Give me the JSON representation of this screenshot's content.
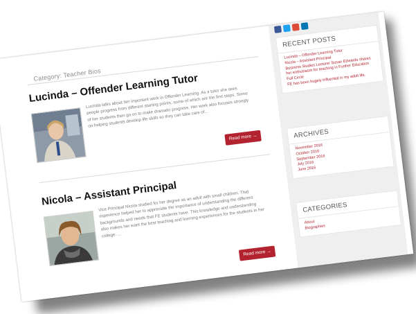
{
  "breadcrumb": "Category: Teacher Bios",
  "posts": [
    {
      "title": "Lucinda – Offender Learning Tutor",
      "excerpt": "Lucinda talks about her important work in Offender Learning. As a tutor she sees people progress from different starting points, some of which are the first steps.  Some of her students then go on to make dramatic progress. Her work also focuses strongly on helping students develop life skills so they can take care of...",
      "read_more": "Read more →"
    },
    {
      "title": "Nicola – Assistant Principal",
      "excerpt": "Vice Principal Nicola studied for her degree as an adult with small children. That experience helped her to appreciate the importance of understanding the different backgrounds and needs that FE students have. This knowledge and understanding also makes her want the best teaching and learning experiences for the students in her college.      ...",
      "read_more": "Read more →"
    }
  ],
  "sidebar": {
    "social_colors": [
      "#3b5998",
      "#1da1f2",
      "#dd4b39",
      "#0077b5"
    ],
    "recent_posts": {
      "title": "RECENT POSTS",
      "items": [
        "Lucinda – Offender Learning Tutor",
        "Nicola – Assistant Principal",
        "Business Studies Lecturer Susan Edwards shares her enthusiasm for teaching in Further Education",
        "Full Circle",
        "FE has been hugely influential in my adult life."
      ]
    },
    "archives": {
      "title": "ARCHIVES",
      "items": [
        "November 2016",
        "October 2016",
        "September 2016",
        "July 2016",
        "June 2016"
      ]
    },
    "categories": {
      "title": "CATEGORIES",
      "items": [
        "About",
        "Biographies"
      ]
    }
  },
  "colors": {
    "accent": "#b3232f",
    "sidebar_bg": "#efefef"
  }
}
